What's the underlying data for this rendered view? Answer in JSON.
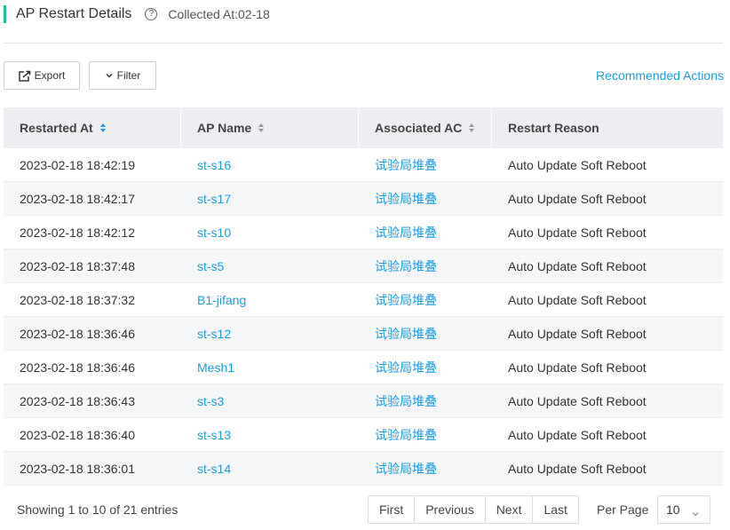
{
  "header": {
    "title": "AP Restart Details",
    "help_symbol": "?",
    "collected": "Collected At:02-18"
  },
  "toolbar": {
    "export_label": "Export",
    "filter_label": "Filter",
    "recommended_actions": "Recommended Actions"
  },
  "table": {
    "columns": [
      {
        "label": "Restarted At",
        "sortable": true,
        "sorted": true
      },
      {
        "label": "AP Name",
        "sortable": true,
        "sorted": false
      },
      {
        "label": "Associated AC",
        "sortable": true,
        "sorted": false
      },
      {
        "label": "Restart Reason",
        "sortable": false,
        "sorted": false
      }
    ],
    "rows": [
      {
        "restarted_at": "2023-02-18 18:42:19",
        "ap_name": "st-s16",
        "ac": "试验局堆叠",
        "reason": "Auto Update Soft Reboot"
      },
      {
        "restarted_at": "2023-02-18 18:42:17",
        "ap_name": "st-s17",
        "ac": "试验局堆叠",
        "reason": "Auto Update Soft Reboot"
      },
      {
        "restarted_at": "2023-02-18 18:42:12",
        "ap_name": "st-s10",
        "ac": "试验局堆叠",
        "reason": "Auto Update Soft Reboot"
      },
      {
        "restarted_at": "2023-02-18 18:37:48",
        "ap_name": "st-s5",
        "ac": "试验局堆叠",
        "reason": "Auto Update Soft Reboot"
      },
      {
        "restarted_at": "2023-02-18 18:37:32",
        "ap_name": "B1-jifang",
        "ac": "试验局堆叠",
        "reason": "Auto Update Soft Reboot"
      },
      {
        "restarted_at": "2023-02-18 18:36:46",
        "ap_name": "st-s12",
        "ac": "试验局堆叠",
        "reason": "Auto Update Soft Reboot"
      },
      {
        "restarted_at": "2023-02-18 18:36:46",
        "ap_name": "Mesh1",
        "ac": "试验局堆叠",
        "reason": "Auto Update Soft Reboot"
      },
      {
        "restarted_at": "2023-02-18 18:36:43",
        "ap_name": "st-s3",
        "ac": "试验局堆叠",
        "reason": "Auto Update Soft Reboot"
      },
      {
        "restarted_at": "2023-02-18 18:36:40",
        "ap_name": "st-s13",
        "ac": "试验局堆叠",
        "reason": "Auto Update Soft Reboot"
      },
      {
        "restarted_at": "2023-02-18 18:36:01",
        "ap_name": "st-s14",
        "ac": "试验局堆叠",
        "reason": "Auto Update Soft Reboot"
      }
    ]
  },
  "footer": {
    "showing": "Showing 1 to 10 of 21 entries",
    "pager": [
      "First",
      "Previous",
      "Next",
      "Last"
    ],
    "per_page_label": "Per Page",
    "per_page_value": "10"
  },
  "colors": {
    "accent": "#1fc0a0",
    "link": "#1a9de0",
    "header_bg": "#eceef1",
    "alt_row_bg": "#f5f6f8"
  },
  "icons": {
    "export": "export-icon",
    "filter": "chevron-down-icon",
    "help": "help-circle-icon",
    "sort": "sort-icon",
    "select": "chevron-down-icon"
  }
}
